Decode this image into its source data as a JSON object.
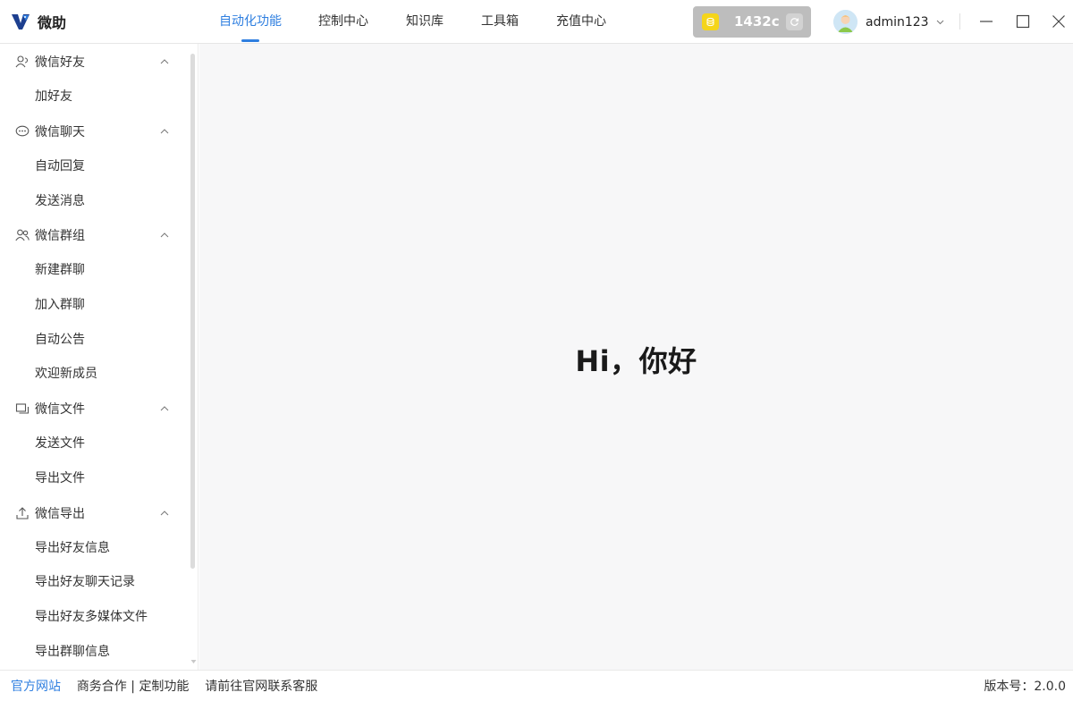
{
  "app": {
    "name": "微助",
    "logo_icon": "vz-logo-icon"
  },
  "nav": {
    "tabs": [
      {
        "label": "自动化功能",
        "active": true
      },
      {
        "label": "控制中心",
        "active": false
      },
      {
        "label": "知识库",
        "active": false
      },
      {
        "label": "工具箱",
        "active": false
      },
      {
        "label": "充值中心",
        "active": false
      }
    ]
  },
  "coins": {
    "value": "1432c",
    "icon": "coin-stack-icon",
    "refresh_icon": "refresh-icon"
  },
  "user": {
    "name": "admin123",
    "avatar_icon": "user-avatar-icon"
  },
  "sidebar": {
    "groups": [
      {
        "label": "微信好友",
        "icon": "friend-icon",
        "items": [
          "加好友"
        ]
      },
      {
        "label": "微信聊天",
        "icon": "chat-bubble-icon",
        "items": [
          "自动回复",
          "发送消息"
        ]
      },
      {
        "label": "微信群组",
        "icon": "group-users-icon",
        "items": [
          "新建群聊",
          "加入群聊",
          "自动公告",
          "欢迎新成员"
        ]
      },
      {
        "label": "微信文件",
        "icon": "file-icon",
        "items": [
          "发送文件",
          "导出文件"
        ]
      },
      {
        "label": "微信导出",
        "icon": "upload-icon",
        "items": [
          "导出好友信息",
          "导出好友聊天记录",
          "导出好友多媒体文件",
          "导出群聊信息"
        ]
      }
    ]
  },
  "main": {
    "greeting": "Hi，你好"
  },
  "footer": {
    "official_site": "官方网站",
    "business": "商务合作",
    "separator": " | ",
    "custom": "定制功能",
    "contact": "请前往官网联系客服",
    "version": "版本号：2.0.0"
  },
  "colors": {
    "accent": "#2f7fe0",
    "coin_bg": "#bdbdbd",
    "coin_icon": "#f5d51a",
    "main_bg": "#f7f7f8"
  }
}
